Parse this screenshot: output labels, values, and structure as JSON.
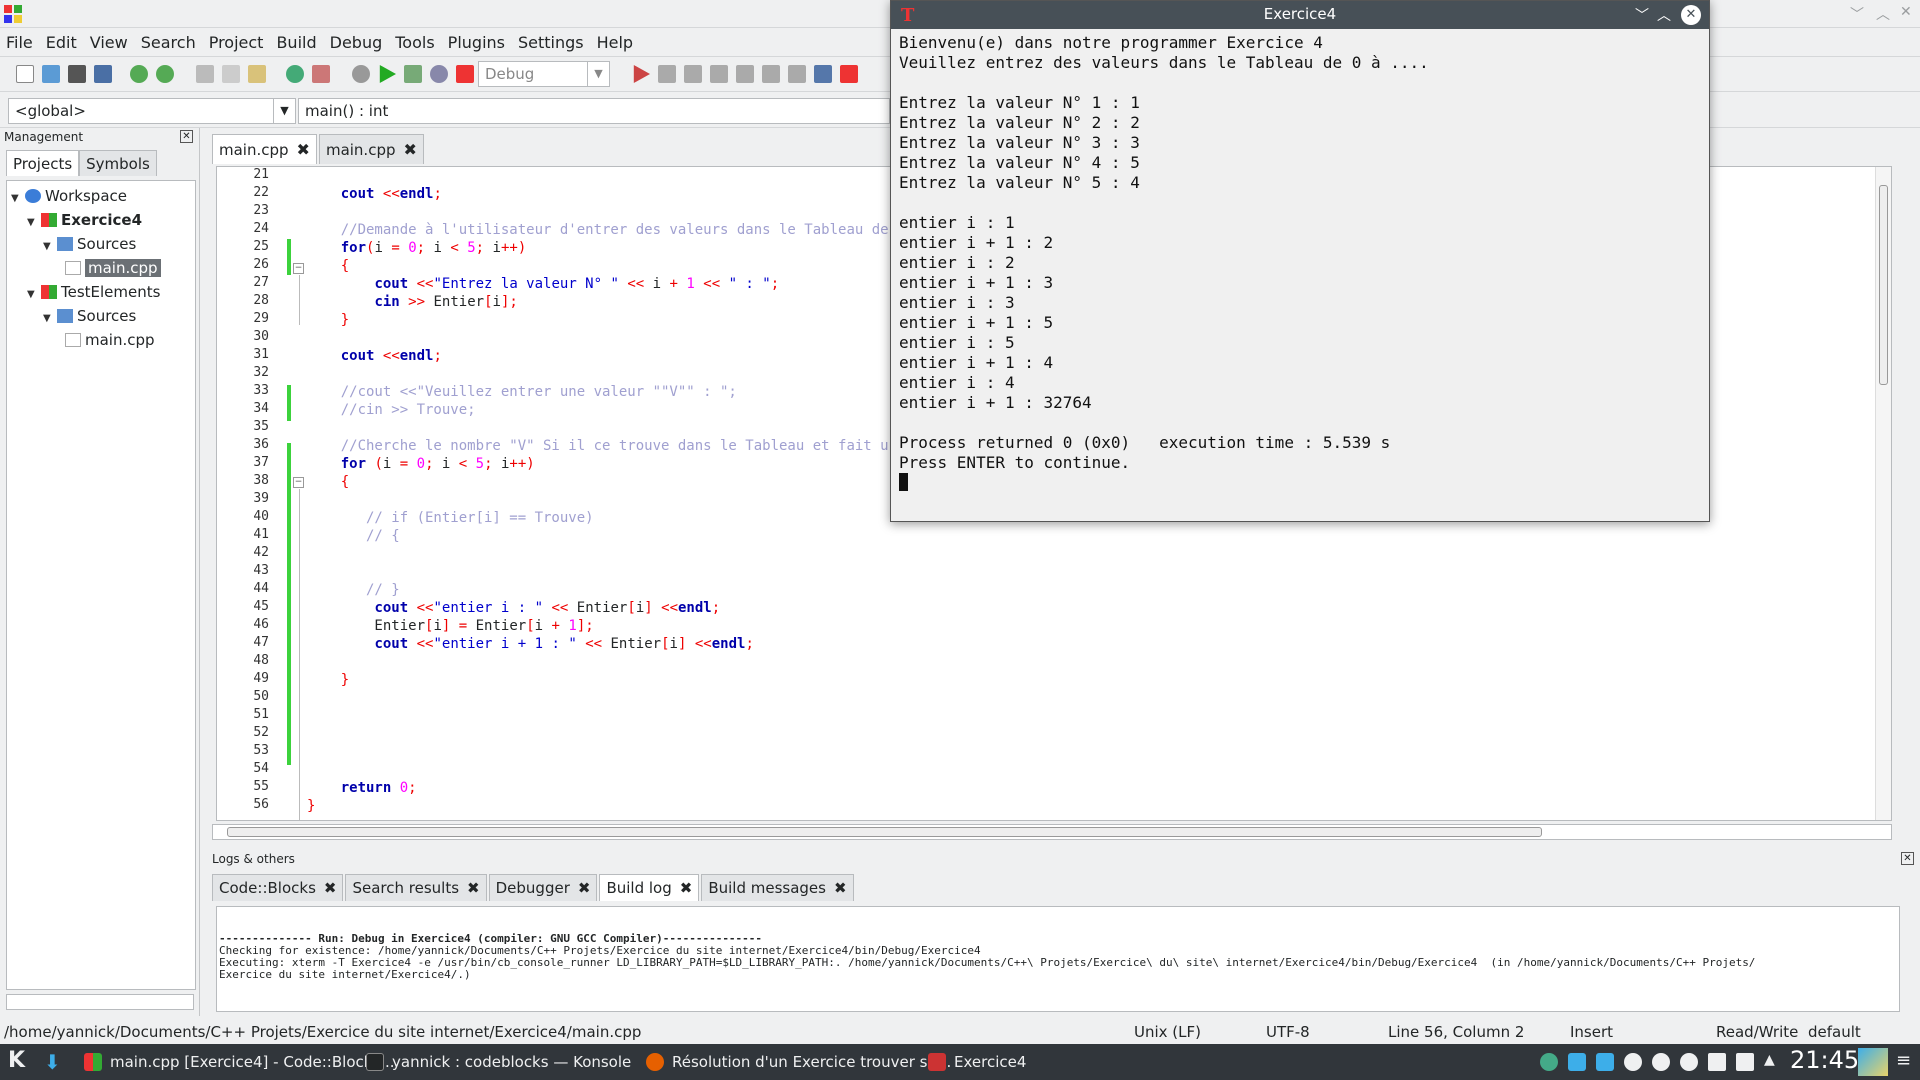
{
  "window": {
    "title": "main.cpp"
  },
  "menu": [
    "File",
    "Edit",
    "View",
    "Search",
    "Project",
    "Build",
    "Debug",
    "Tools",
    "Plugins",
    "Settings",
    "Help"
  ],
  "toolbar": {
    "build_target": "Debug"
  },
  "scope": {
    "global": "<global>",
    "function": "main() : int"
  },
  "management": {
    "title": "Management",
    "tabs": [
      "Projects",
      "Symbols"
    ],
    "tree": [
      {
        "label": "Workspace",
        "level": 0,
        "icon": "workspace-icon"
      },
      {
        "label": "Exercice4",
        "level": 1,
        "icon": "project-icon",
        "bold": true
      },
      {
        "label": "Sources",
        "level": 2,
        "icon": "folder-icon"
      },
      {
        "label": "main.cpp",
        "level": 3,
        "icon": "file-icon",
        "selected": true
      },
      {
        "label": "TestElements",
        "level": 1,
        "icon": "project-icon"
      },
      {
        "label": "Sources",
        "level": 2,
        "icon": "folder-icon"
      },
      {
        "label": "main.cpp",
        "level": 3,
        "icon": "file-icon"
      }
    ]
  },
  "editor": {
    "tabs": [
      "main.cpp",
      "main.cpp"
    ],
    "line_numbers": [
      "21",
      "22",
      "23",
      "24",
      "25",
      "26",
      "27",
      "28",
      "29",
      "30",
      "31",
      "32",
      "33",
      "34",
      "35",
      "36",
      "37",
      "38",
      "39",
      "40",
      "41",
      "42",
      "43",
      "44",
      "45",
      "46",
      "47",
      "48",
      "49",
      "50",
      "51",
      "52",
      "53",
      "54",
      "55",
      "56"
    ],
    "lines": [
      "",
      "    cout <<endl;",
      "",
      "    //Demande à l'utilisateur d'entrer des valeurs dans le Tableau de 0 à",
      "    for(i = 0; i < 5; i++)",
      "    {",
      "        cout <<\"Entrez la valeur N° \" << i + 1 << \" : \";",
      "        cin >> Entier[i];",
      "    }",
      "",
      "    cout <<endl;",
      "",
      "    //cout <<\"Veuillez entrer une valeur \"\"V\"\" : \";",
      "    //cin >> Trouve;",
      "",
      "    //Cherche le nombre \"V\" Si il ce trouve dans le Tableau et fait un Dé",
      "    for (i = 0; i < 5; i++)",
      "    {",
      "",
      "       // if (Entier[i] == Trouve)",
      "       // {",
      "",
      "",
      "       // }",
      "        cout <<\"entier i : \" << Entier[i] <<endl;",
      "        Entier[i] = Entier[i + 1];",
      "        cout <<\"entier i + 1 : \" << Entier[i] <<endl;",
      "",
      "    }",
      "",
      "",
      "",
      "",
      "",
      "    return 0;",
      "}"
    ]
  },
  "logs": {
    "title": "Logs & others",
    "tabs": [
      "Code::Blocks",
      "Search results",
      "Debugger",
      "Build log",
      "Build messages"
    ],
    "lines": [
      "-------------- Run: Debug in Exercice4 (compiler: GNU GCC Compiler)---------------",
      "Checking for existence: /home/yannick/Documents/C++ Projets/Exercice du site internet/Exercice4/bin/Debug/Exercice4",
      "Executing: xterm -T Exercice4 -e /usr/bin/cb_console_runner LD_LIBRARY_PATH=$LD_LIBRARY_PATH:. /home/yannick/Documents/C++\\ Projets/Exercice\\ du\\ site\\ internet/Exercice4/bin/Debug/Exercice4  (in /home/yannick/Documents/C++ Projets/",
      "Exercice du site internet/Exercice4/.)"
    ]
  },
  "status": {
    "path": "/home/yannick/Documents/C++ Projets/Exercice du site internet/Exercice4/main.cpp",
    "eol": "Unix (LF)",
    "encoding": "UTF-8",
    "position": "Line 56, Column 2",
    "mode": "Insert",
    "access": "Read/Write",
    "lang": "default"
  },
  "console": {
    "title": "Exercice4",
    "lines": [
      "Bienvenu(e) dans notre programmer Exercice 4",
      "Veuillez entrez des valeurs dans le Tableau de 0 à ....",
      "",
      "Entrez la valeur N° 1 : 1",
      "Entrez la valeur N° 2 : 2",
      "Entrez la valeur N° 3 : 3",
      "Entrez la valeur N° 4 : 5",
      "Entrez la valeur N° 5 : 4",
      "",
      "entier i : 1",
      "entier i + 1 : 2",
      "entier i : 2",
      "entier i + 1 : 3",
      "entier i : 3",
      "entier i + 1 : 5",
      "entier i : 5",
      "entier i + 1 : 4",
      "entier i : 4",
      "entier i + 1 : 32764",
      "",
      "Process returned 0 (0x0)   execution time : 5.539 s",
      "Press ENTER to continue."
    ]
  },
  "taskbar": {
    "tasks": [
      "main.cpp [Exercice4] - Code::Blocks...",
      "yannick : codeblocks — Konsole",
      "Résolution d'un Exercice trouver su...",
      "Exercice4"
    ],
    "clock": "21:45"
  },
  "colors": {
    "accent": "#3daee9",
    "change_bar": "#3cd23c",
    "taskbar": "#31363b"
  }
}
